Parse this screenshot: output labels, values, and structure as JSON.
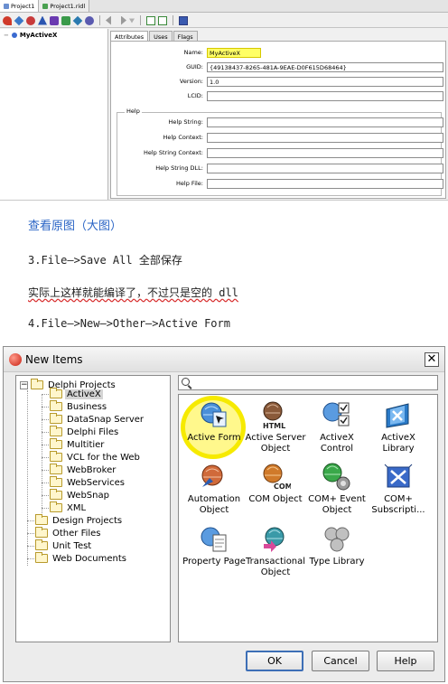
{
  "top_panel": {
    "file_tabs": [
      "Project1",
      "Project1.ridl"
    ],
    "tree_root": "MyActiveX",
    "attr_tabs": [
      "Attributes",
      "Uses",
      "Flags"
    ],
    "fields": [
      {
        "label": "Name:",
        "value": "MyActiveX"
      },
      {
        "label": "GUID:",
        "value": "{49138437-8265-481A-9EAE-D0F615D68464}"
      },
      {
        "label": "Version:",
        "value": "1.0"
      },
      {
        "label": "LCID:",
        "value": ""
      }
    ],
    "help_group_title": "Help",
    "help_fields": [
      {
        "label": "Help String:",
        "value": ""
      },
      {
        "label": "Help Context:",
        "value": ""
      },
      {
        "label": "Help String Context:",
        "value": ""
      },
      {
        "label": "Help String DLL:",
        "value": ""
      },
      {
        "label": "Help File:",
        "value": ""
      }
    ]
  },
  "blog": {
    "link": "查看原图（大图）",
    "step3": "3.File—>Save All 全部保存",
    "note": "实际上这样就能编译了，不过只是空的 dll",
    "step4": "4.File—>New—>Other—>Active Form"
  },
  "dialog": {
    "title": "New Items",
    "close_glyph": "✕",
    "tree": [
      {
        "label": "Delphi Projects",
        "expanded": true
      },
      {
        "label": "ActiveX",
        "selected": true
      },
      {
        "label": "Business"
      },
      {
        "label": "DataSnap Server"
      },
      {
        "label": "Delphi Files"
      },
      {
        "label": "Multitier"
      },
      {
        "label": "VCL for the Web"
      },
      {
        "label": "WebBroker"
      },
      {
        "label": "WebServices"
      },
      {
        "label": "WebSnap"
      },
      {
        "label": "XML"
      },
      {
        "label": "Design Projects"
      },
      {
        "label": "Other Files"
      },
      {
        "label": "Unit Test"
      },
      {
        "label": "Web Documents"
      }
    ],
    "search_value": "",
    "items": [
      {
        "label": "Active Form",
        "highlighted": true
      },
      {
        "label": "Active Server Object",
        "icon_text": "HTML"
      },
      {
        "label": "ActiveX Control"
      },
      {
        "label": "ActiveX Library"
      },
      {
        "label": "Automation Object"
      },
      {
        "label": "COM Object",
        "icon_text": "COM"
      },
      {
        "label": "COM+ Event Object"
      },
      {
        "label": "COM+ Subscripti..."
      },
      {
        "label": "Property Page"
      },
      {
        "label": "Transactional Object"
      },
      {
        "label": "Type Library"
      }
    ],
    "buttons": {
      "ok": "OK",
      "cancel": "Cancel",
      "help": "Help"
    }
  }
}
